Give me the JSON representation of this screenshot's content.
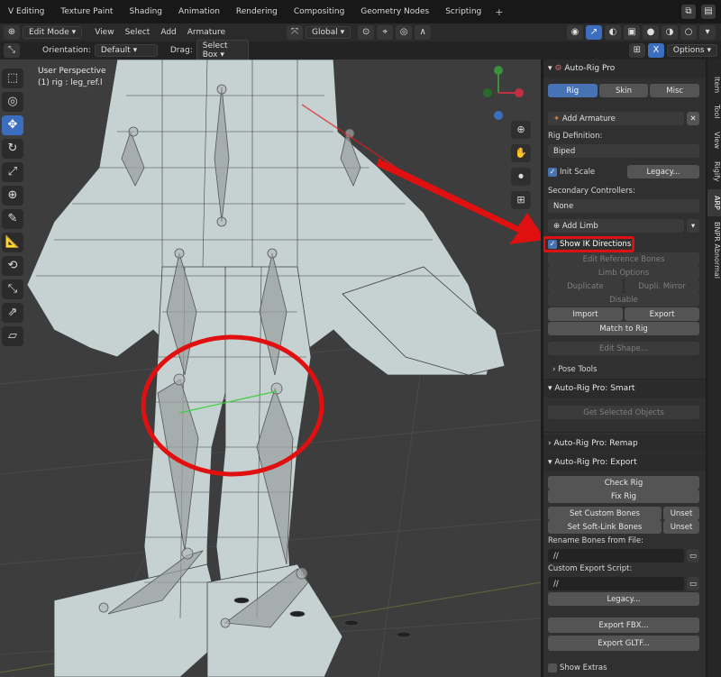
{
  "workspace_tabs": [
    "V Editing",
    "Texture Paint",
    "Shading",
    "Animation",
    "Rendering",
    "Compositing",
    "Geometry Nodes",
    "Scripting",
    "+"
  ],
  "header": {
    "mode": "Edit Mode",
    "menus": [
      "View",
      "Select",
      "Add",
      "Armature"
    ],
    "transform_orientation": "Global",
    "options": "Options",
    "x_label": "X"
  },
  "toolrow": {
    "orientation_label": "Orientation:",
    "orientation_value": "Default",
    "drag_label": "Drag:",
    "drag_value": "Select Box"
  },
  "viewport": {
    "line1": "User Perspective",
    "line2": "(1) rig : leg_ref.l"
  },
  "sidebar_tabs": [
    "Item",
    "Tool",
    "View",
    "Rigify",
    "ARP",
    "BNPR Abnormal"
  ],
  "panel": {
    "title": "Auto-Rig Pro",
    "tabs": [
      "Rig",
      "Skin",
      "Misc"
    ],
    "add_armature": "Add Armature",
    "rig_definition_label": "Rig Definition:",
    "rig_definition_value": "Biped",
    "init_scale": "Init Scale",
    "legacy": "Legacy...",
    "secondary_label": "Secondary Controllers:",
    "secondary_value": "None",
    "add_limb": "Add Limb",
    "show_ik": "Show IK Directions",
    "edit_ref": "Edit Reference Bones",
    "limb_options": "Limb Options",
    "duplicate": "Duplicate",
    "dupli_mirror": "Dupli. Mirror",
    "disable": "Disable",
    "import": "Import",
    "export": "Export",
    "match_to_rig": "Match to Rig",
    "edit_shape": "Edit Shape...",
    "pose_tools": "Pose Tools",
    "smart_title": "Auto-Rig Pro: Smart",
    "get_selected": "Get Selected Objects",
    "remap_title": "Auto-Rig Pro: Remap",
    "export_title": "Auto-Rig Pro: Export",
    "check_rig": "Check Rig",
    "fix_rig": "Fix Rig",
    "set_custom": "Set Custom Bones",
    "unset": "Unset",
    "set_soft": "Set Soft-Link Bones",
    "unset2": "Unset",
    "rename_label": "Rename Bones from File:",
    "rename_value": "//",
    "custom_script_label": "Custom Export Script:",
    "custom_script_value": "//",
    "legacy2": "Legacy...",
    "export_fbx": "Export FBX...",
    "export_gltf": "Export GLTF...",
    "show_extras": "Show Extras"
  },
  "colors": {
    "accent": "#4772b3",
    "highlight_red": "#e01010",
    "mesh": "#c9d4d4"
  }
}
